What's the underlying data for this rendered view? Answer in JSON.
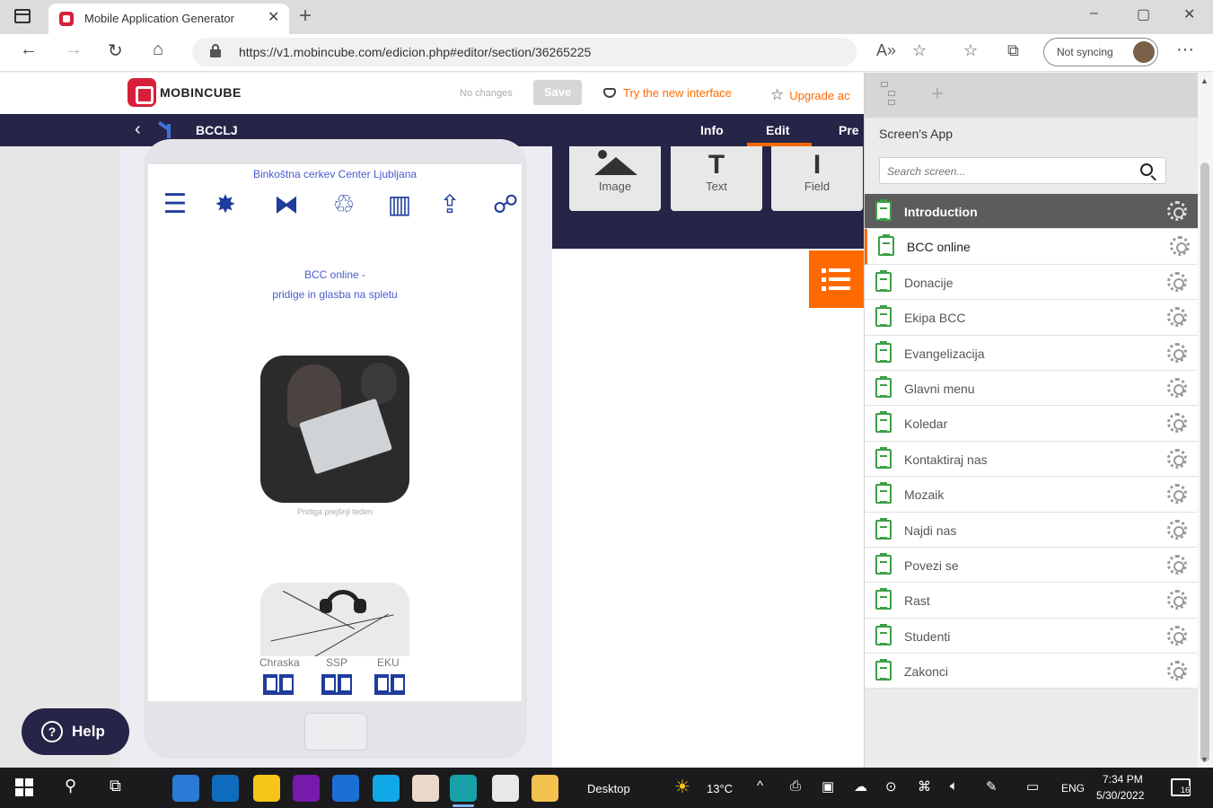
{
  "browser": {
    "tab_title": "Mobile Application Generator",
    "tab_close": "✕",
    "new_tab": "+",
    "url": "https://v1.mobincube.com/edicion.php#editor/section/36265225",
    "sync_label": "Not syncing",
    "minimize": "–",
    "maximize": "▢",
    "close": "✕",
    "back": "←",
    "forward": "→",
    "refresh": "↻",
    "home": "⌂",
    "read_aloud": "A»",
    "favorites_add": "☆",
    "favorites": "☆",
    "collections": "⧉",
    "more": "···"
  },
  "app_header": {
    "logo_text": "MOBINCUBE",
    "status": "No changes",
    "save_label": "Save",
    "try_new_interface": "Try the new interface",
    "upgrade": "Upgrade ac"
  },
  "navbar": {
    "back": "‹",
    "app_name": "BCCLJ",
    "tabs": [
      "Info",
      "Edit",
      "Pre"
    ]
  },
  "components": [
    {
      "label": "Image",
      "icon": "image-icon"
    },
    {
      "label": "Text",
      "icon": "text-icon",
      "glyph": "T"
    },
    {
      "label": "Field",
      "icon": "field-icon",
      "glyph": "I"
    }
  ],
  "phone": {
    "church_title": "Binkoštna cerkev Center Ljubljana",
    "intro_line1": "BCC online -",
    "intro_line2": "pridige in glasba na spletu",
    "photo_caption": "Pridiga prejšnji teden",
    "icons": [
      "list-icon",
      "gear-badge-icon",
      "network-icon",
      "donate-icon",
      "book-icon",
      "share-icon",
      "collab-icon"
    ],
    "icon_glyphs": [
      "☰",
      "✸",
      "⧓",
      "♲",
      "▥",
      "⇪",
      "☍"
    ],
    "book_labels": [
      "Chraska",
      "SSP",
      "EKU"
    ]
  },
  "help": {
    "label": "Help",
    "icon_glyph": "?"
  },
  "sidebar": {
    "title": "Screen's App",
    "add": "+",
    "search_placeholder": "Search screen...",
    "screens": [
      {
        "label": "Introduction",
        "state": "active"
      },
      {
        "label": "BCC online",
        "state": "selected"
      },
      {
        "label": "Donacije",
        "state": ""
      },
      {
        "label": "Ekipa BCC",
        "state": ""
      },
      {
        "label": "Evangelizacija",
        "state": ""
      },
      {
        "label": "Glavni menu",
        "state": ""
      },
      {
        "label": "Koledar",
        "state": ""
      },
      {
        "label": "Kontaktiraj nas",
        "state": ""
      },
      {
        "label": "Mozaik",
        "state": ""
      },
      {
        "label": "Najdi nas",
        "state": ""
      },
      {
        "label": "Povezi se",
        "state": ""
      },
      {
        "label": "Rast",
        "state": ""
      },
      {
        "label": "Studenti",
        "state": ""
      },
      {
        "label": "Zakonci",
        "state": ""
      }
    ],
    "scroll_up": "▲",
    "scroll_down": "▼"
  },
  "taskbar": {
    "desktop_label": "Desktop",
    "temperature": "13°C",
    "language": "ENG",
    "time": "7:34 PM",
    "date": "5/30/2022",
    "notifications": "16",
    "search_glyph": "⚲",
    "taskview_glyph": "⧉",
    "sys_glyphs": [
      "^",
      "⎙",
      "▣",
      "☁",
      "⊙",
      "⌘",
      "🔈︎",
      "✎",
      "▭"
    ],
    "apps": [
      {
        "name": "mail-app",
        "color": "#2a7bd6"
      },
      {
        "name": "outlook-app",
        "color": "#0f6cbd"
      },
      {
        "name": "sticky-notes-app",
        "color": "#f5c518"
      },
      {
        "name": "onenote-app",
        "color": "#7719aa"
      },
      {
        "name": "trello-app",
        "color": "#1d6fd8"
      },
      {
        "name": "skype-app",
        "color": "#10a8e6"
      },
      {
        "name": "office-app",
        "color": "#e8d9c8"
      },
      {
        "name": "edge-app",
        "color": "#17a0a8"
      },
      {
        "name": "calendar-app",
        "color": "#e8e8e8"
      },
      {
        "name": "file-explorer-app",
        "color": "#f2c14e"
      }
    ]
  }
}
